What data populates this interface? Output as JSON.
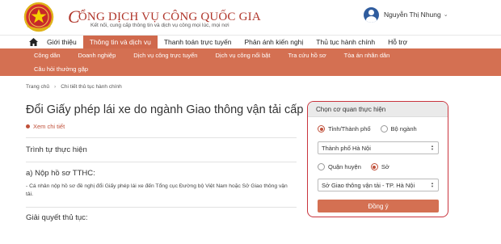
{
  "header": {
    "title_initial": "C",
    "title_rest": "ỔNG DỊCH VỤ CÔNG QUỐC GIA",
    "subtitle": "Kết nối, cung cấp thông tin và dịch vụ công mọi lúc, mọi nơi",
    "user_name": "Nguyễn Thị Nhung"
  },
  "nav": {
    "items": [
      {
        "label": "Giới thiệu"
      },
      {
        "label": "Thông tin và dịch vụ"
      },
      {
        "label": "Thanh toán trực tuyến"
      },
      {
        "label": "Phản ánh kiến nghị"
      },
      {
        "label": "Thủ tục hành chính"
      },
      {
        "label": "Hỗ trợ"
      }
    ],
    "active_index": 1
  },
  "subnav": {
    "items": [
      {
        "label": "Công dân"
      },
      {
        "label": "Doanh nghiệp"
      },
      {
        "label": "Dịch vụ công trực tuyến"
      },
      {
        "label": "Dịch vụ công nổi bật"
      },
      {
        "label": "Tra cứu hồ sơ"
      },
      {
        "label": "Tòa án nhân dân"
      },
      {
        "label": "Câu hỏi thường gặp"
      }
    ]
  },
  "breadcrumb": {
    "home": "Trang chủ",
    "current": "Chi tiết thủ tục hành chính"
  },
  "content": {
    "title": "Đổi Giấy phép lái xe do ngành Giao thông vận tải cấp",
    "detail_link": "Xem chi tiết",
    "section1": "Trình tự thực hiện",
    "section2": "a) Nộp hồ sơ TTHC:",
    "section2_text": "- Cá nhân nộp hồ sơ đề nghị đổi Giấy phép lái xe đến Tổng cục Đường bộ Việt Nam hoặc Sở Giao thông vận tải.",
    "section3": "Giải quyết thủ tục:"
  },
  "panel": {
    "header": "Chọn cơ quan thực hiện",
    "radio1": {
      "label": "Tỉnh/Thành phố",
      "checked": true
    },
    "radio2": {
      "label": "Bộ ngành",
      "checked": false
    },
    "select1_value": "Thành phố Hà Nội",
    "radio3": {
      "label": "Quận huyện",
      "checked": false
    },
    "radio4": {
      "label": "Sở",
      "checked": true
    },
    "select2_value": "Sở Giao thông vận tải - TP. Hà Nội",
    "submit_label": "Đồng ý"
  },
  "colors": {
    "brand_red": "#b0362b",
    "accent_orange": "#d47052",
    "panel_border": "#c9343d"
  }
}
